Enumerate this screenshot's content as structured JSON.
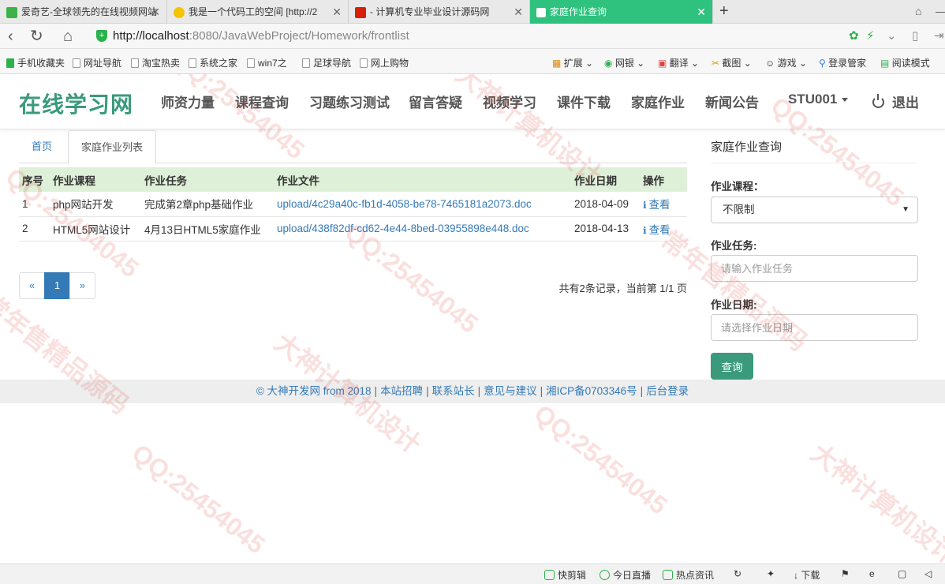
{
  "browser": {
    "tabs": [
      {
        "title": "爱奇艺-全球领先的在线视频网站",
        "active": false
      },
      {
        "title": "我是一个代码工的空间 [http://2",
        "active": false
      },
      {
        "title": "- 计算机专业毕业设计源码网",
        "active": false
      },
      {
        "title": "家庭作业查询",
        "active": true
      }
    ],
    "new_tab": "+",
    "url_host": "http://localhost",
    "url_path": ":8080/JavaWebProject/Homework/frontlist",
    "bookmarks": [
      "手机收藏夹",
      "网址导航",
      "淘宝热卖",
      "系统之家",
      "win7之",
      "足球导航",
      "网上购物"
    ],
    "toolbar_items": [
      "扩展",
      "网银",
      "翻译",
      "截图",
      "游戏",
      "登录管家",
      "阅读模式"
    ]
  },
  "site": {
    "brand": "在线学习网",
    "nav": [
      "师资力量",
      "课程查询",
      "习题练习测试",
      "留言答疑",
      "视频学习",
      "课件下载",
      "家庭作业",
      "新闻公告"
    ],
    "user": "STU001",
    "logout": "退出"
  },
  "content_tabs": {
    "home": "首页",
    "list": "家庭作业列表"
  },
  "table": {
    "headers": [
      "序号",
      "作业课程",
      "作业任务",
      "作业文件",
      "作业日期",
      "操作"
    ],
    "rows": [
      {
        "no": "1",
        "course": "php网站开发",
        "task": "完成第2章php基础作业",
        "file": "upload/4c29a40c-fb1d-4058-be78-7465181a2073.doc",
        "date": "2018-04-09",
        "action": "查看"
      },
      {
        "no": "2",
        "course": "HTML5网站设计",
        "task": "4月13日HTML5家庭作业",
        "file": "upload/438f82df-cd62-4e44-8bed-03955898e448.doc",
        "date": "2018-04-13",
        "action": "查看"
      }
    ]
  },
  "pagination": {
    "prev": "«",
    "current": "1",
    "next": "»",
    "summary": "共有2条记录，当前第 1/1 页"
  },
  "query": {
    "title": "家庭作业查询",
    "course_label": "作业课程：",
    "course_value": "不限制",
    "task_label": "作业任务:",
    "task_placeholder": "请输入作业任务",
    "date_label": "作业日期:",
    "date_placeholder": "请选择作业日期",
    "submit": "查询"
  },
  "footer": {
    "copyright": "© 大神开发网 from 2018",
    "links": [
      "本站招聘",
      "联系站长",
      "意见与建议",
      "湘ICP备0703346号",
      "后台登录"
    ]
  },
  "statusbar": [
    "快剪辑",
    "今日直播",
    "热点资讯",
    "下载"
  ],
  "watermark_texts": [
    "QQ:25454045",
    "大神计算机设计",
    "常年售精品源码"
  ],
  "colors": {
    "brand": "#3a9a7b",
    "link": "#337ab7",
    "table_header": "#dff0d8",
    "active_tab": "#2ec27e"
  }
}
